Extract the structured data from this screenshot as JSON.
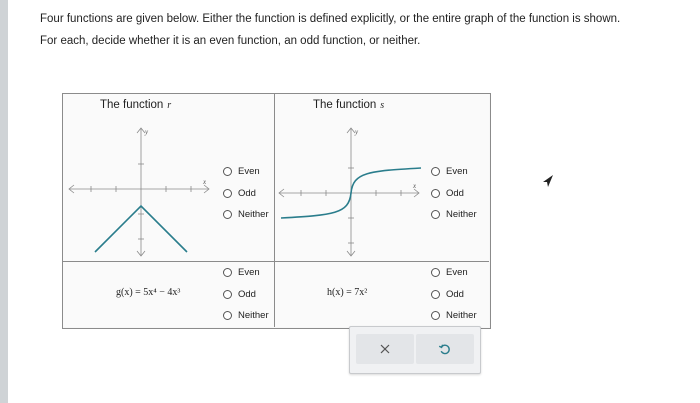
{
  "instructions": {
    "line1": "Four functions are given below. Either the function is defined explicitly, or the entire graph of the function is shown.",
    "line2": "For each, decide whether it is an even function, an odd function, or neither."
  },
  "cells": {
    "r": {
      "title_prefix": "The function",
      "var": "r"
    },
    "s": {
      "title_prefix": "The function",
      "var": "s"
    },
    "g": {
      "formula": "g(x) = 5x⁴ − 4x³"
    },
    "h": {
      "formula": "h(x) = 7x²"
    }
  },
  "graph": {
    "y_label": "y",
    "x_label": "x"
  },
  "options": {
    "even": "Even",
    "odd": "Odd",
    "neither": "Neither"
  },
  "actions": {
    "clear_icon": "x-icon",
    "undo_icon": "undo-icon"
  },
  "colors": {
    "curve": "#2a7d8c",
    "axis": "#8a8a8a",
    "border": "#8b8b8b"
  }
}
